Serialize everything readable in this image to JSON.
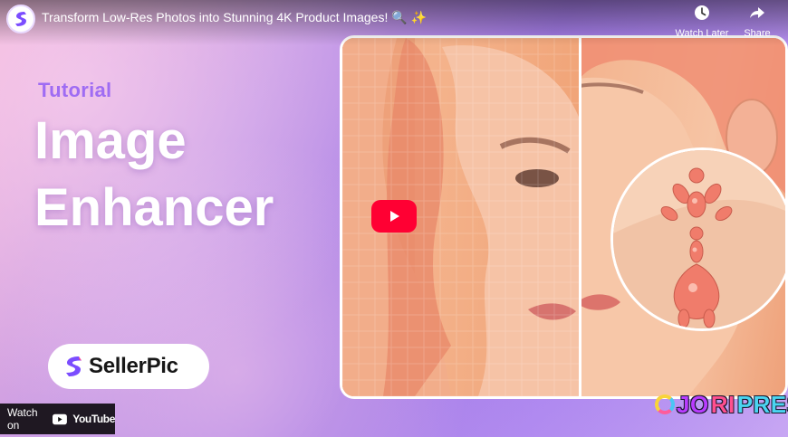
{
  "video": {
    "title": "Transform Low-Res Photos into Stunning 4K Product Images! 🔍 ✨",
    "watch_later_label": "Watch Later",
    "share_label": "Share",
    "watch_on_label": "Watch on",
    "youtube_label": "YouTube"
  },
  "thumbnail": {
    "kicker": "Tutorial",
    "title_line1": "Image",
    "title_line2": "Enhancer",
    "brand_name": "SellerPic"
  },
  "watermark": {
    "part1": "JO",
    "part2": "RI",
    "part3": "PRESS"
  },
  "colors": {
    "play_button": "#ff0033",
    "kicker": "#9f6cf3",
    "brand_mark": "#7b4dff"
  },
  "icons": {
    "watch_later": "clock-icon",
    "share": "share-arrow-icon",
    "play": "play-icon",
    "youtube": "youtube-logo"
  }
}
